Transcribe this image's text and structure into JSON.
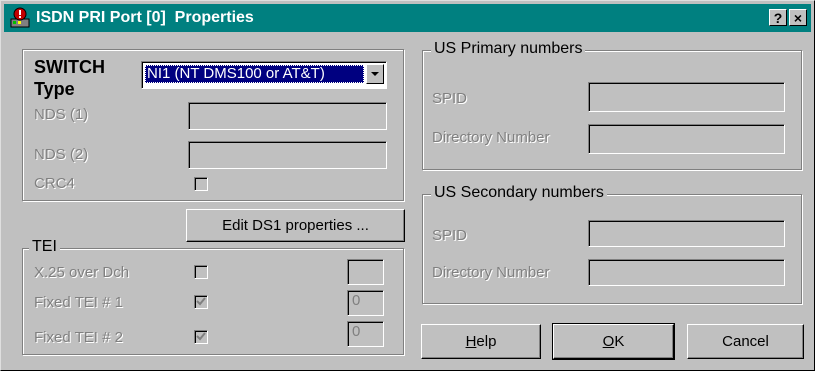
{
  "window": {
    "title": "ISDN PRI Port [0]  Properties",
    "help_glyph": "?",
    "close_glyph": "×",
    "titlebar_color": "#008080",
    "face_color": "#c0c0c0"
  },
  "switch": {
    "label_line1": "SWITCH",
    "label_line2": "Type",
    "selected": "NI1 (NT DMS100 or AT&T)",
    "nds1_label": "NDS (1)",
    "nds1_value": "",
    "nds2_label": "NDS (2)",
    "nds2_value": "",
    "crc4_label": "CRC4",
    "crc4_checked": false
  },
  "edit_ds1_button": "Edit DS1 properties ...",
  "tei": {
    "legend": "TEI",
    "rows": [
      {
        "label": "X.25 over Dch",
        "checked": false,
        "value": ""
      },
      {
        "label": "Fixed TEI # 1",
        "checked": true,
        "value": "0"
      },
      {
        "label": "Fixed TEI # 2",
        "checked": true,
        "value": "0"
      }
    ]
  },
  "primary": {
    "legend": "US Primary numbers",
    "spid_label": "SPID",
    "spid_value": "",
    "dirnum_label": "Directory Number",
    "dirnum_value": ""
  },
  "secondary": {
    "legend": "US Secondary numbers",
    "spid_label": "SPID",
    "spid_value": "",
    "dirnum_label": "Directory Number",
    "dirnum_value": ""
  },
  "buttons": {
    "help_mnemonic": "H",
    "help_rest": "elp",
    "ok_mnemonic": "O",
    "ok_rest": "K",
    "cancel": "Cancel"
  }
}
